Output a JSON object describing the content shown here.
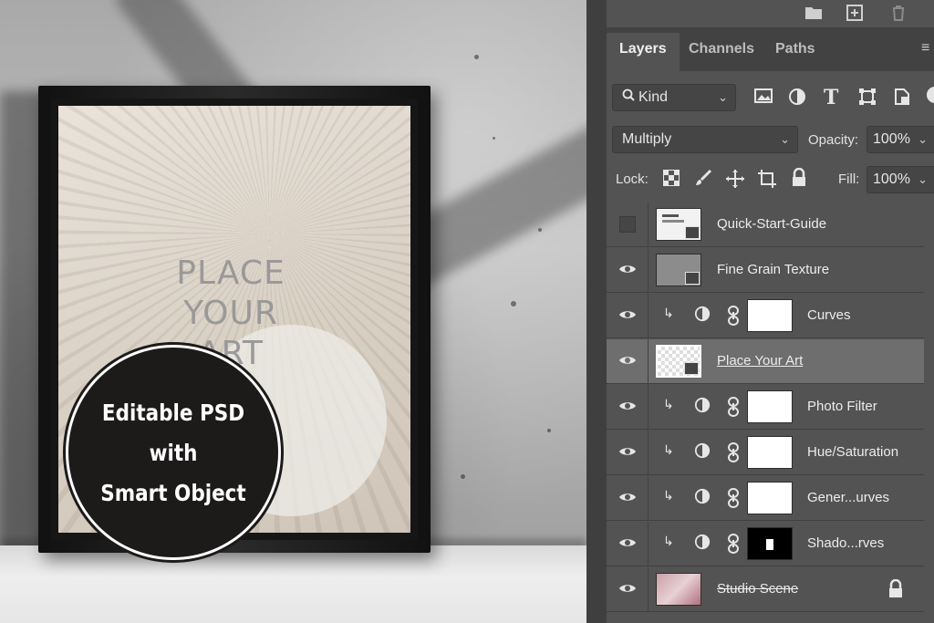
{
  "mockup": {
    "art_placeholder": [
      "PLACE",
      "YOUR",
      "ART"
    ],
    "badge_lines": [
      "Editable PSD",
      "with",
      "Smart Object"
    ]
  },
  "toolbar": {
    "icons": [
      "folder-icon",
      "new-layer-icon",
      "trash-icon"
    ]
  },
  "tabs": [
    {
      "label": "Layers",
      "active": true
    },
    {
      "label": "Channels",
      "active": false
    },
    {
      "label": "Paths",
      "active": false
    }
  ],
  "filter": {
    "kind_label": "Kind",
    "icons": [
      "image-filter-icon",
      "adjustment-filter-icon",
      "type-filter-icon",
      "shape-filter-icon",
      "smart-object-filter-icon"
    ]
  },
  "blend": {
    "mode": "Multiply",
    "opacity_label": "Opacity:",
    "opacity_value": "100%"
  },
  "lock": {
    "label": "Lock:",
    "fill_label": "Fill:",
    "fill_value": "100%"
  },
  "layers": [
    {
      "name": "Quick-Start-Guide",
      "visible": false,
      "type": "smart-object"
    },
    {
      "name": "Fine Grain Texture",
      "visible": true,
      "type": "smart-object"
    },
    {
      "name": "Curves",
      "visible": true,
      "type": "adjustment",
      "mask": "white"
    },
    {
      "name": "Place Your Art",
      "visible": true,
      "type": "smart-object",
      "selected": true
    },
    {
      "name": "Photo Filter",
      "visible": true,
      "type": "adjustment",
      "mask": "white"
    },
    {
      "name": "Hue/Saturation",
      "visible": true,
      "type": "adjustment",
      "mask": "white"
    },
    {
      "name": "Gener...urves",
      "visible": true,
      "type": "adjustment",
      "mask": "white"
    },
    {
      "name": "Shado...rves",
      "visible": true,
      "type": "adjustment",
      "mask": "black"
    },
    {
      "name": "Studio Scene",
      "visible": true,
      "type": "locked-image"
    }
  ],
  "colors": {
    "panel_bg": "#535353",
    "selected_row": "#6e6e6e",
    "tab_bar": "#424242",
    "badge": "#1d1a1a"
  }
}
